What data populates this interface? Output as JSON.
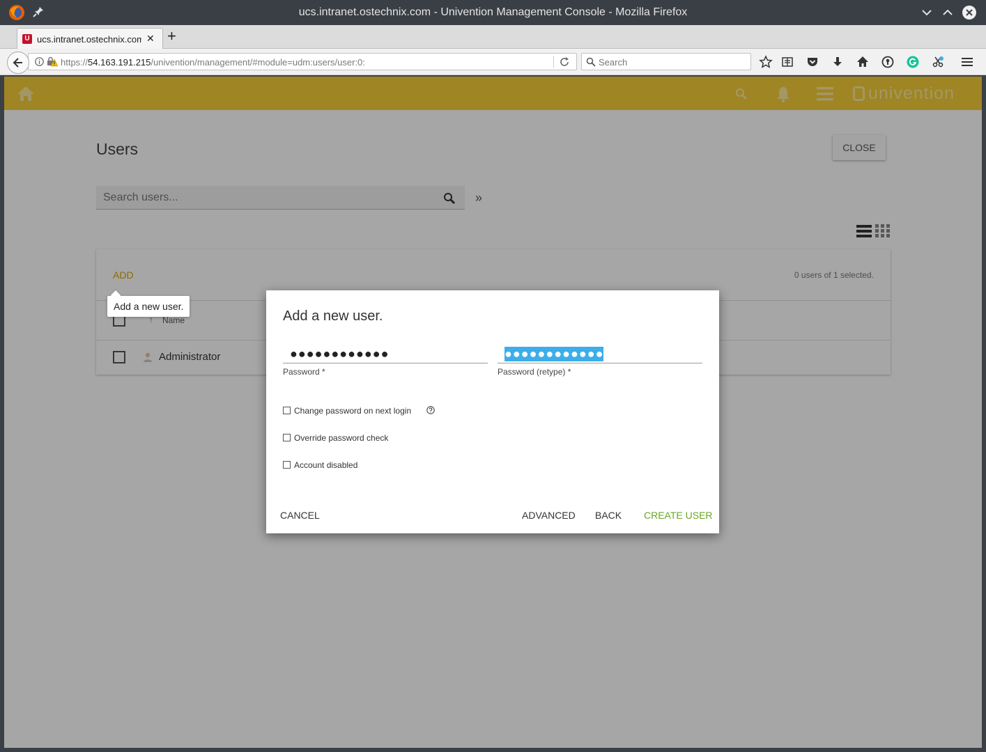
{
  "window": {
    "title": "ucs.intranet.ostechnix.com - Univention Management Console - Mozilla Firefox"
  },
  "tab": {
    "title": "ucs.intranet.ostechnix.com",
    "close": "✕",
    "new_tab": "+"
  },
  "url": {
    "scheme": "https://",
    "host": "54.163.191.215",
    "path": "/univention/management/#module=udm:users/user:0:"
  },
  "search": {
    "placeholder": "Search"
  },
  "header": {
    "brand": "univention",
    "color": "#f4cd37"
  },
  "page": {
    "title": "Users",
    "close_label": "CLOSE",
    "search_placeholder": "Search users...",
    "more_label": "»"
  },
  "grid": {
    "add_label": "ADD",
    "selection_status": "0 users of 1 selected.",
    "sort_icon": "↑",
    "column_name": "Name",
    "rows": [
      {
        "name": "Administrator"
      }
    ]
  },
  "tooltip": {
    "text": "Add a new user."
  },
  "dialog": {
    "title": "Add a new user.",
    "password_mask": "●●●●●●●●●●●●",
    "password_label": "Password *",
    "password_retype_mask": "●●●●●●●●●●●●",
    "password_retype_label": "Password (retype) *",
    "options": [
      {
        "label": "Change password on next login",
        "checked": false
      },
      {
        "label": "Override password check",
        "checked": false
      },
      {
        "label": "Account disabled",
        "checked": false
      }
    ],
    "buttons": {
      "cancel": "CANCEL",
      "advanced": "ADVANCED",
      "back": "BACK",
      "create": "CREATE USER"
    },
    "accent": "#6aa623"
  }
}
